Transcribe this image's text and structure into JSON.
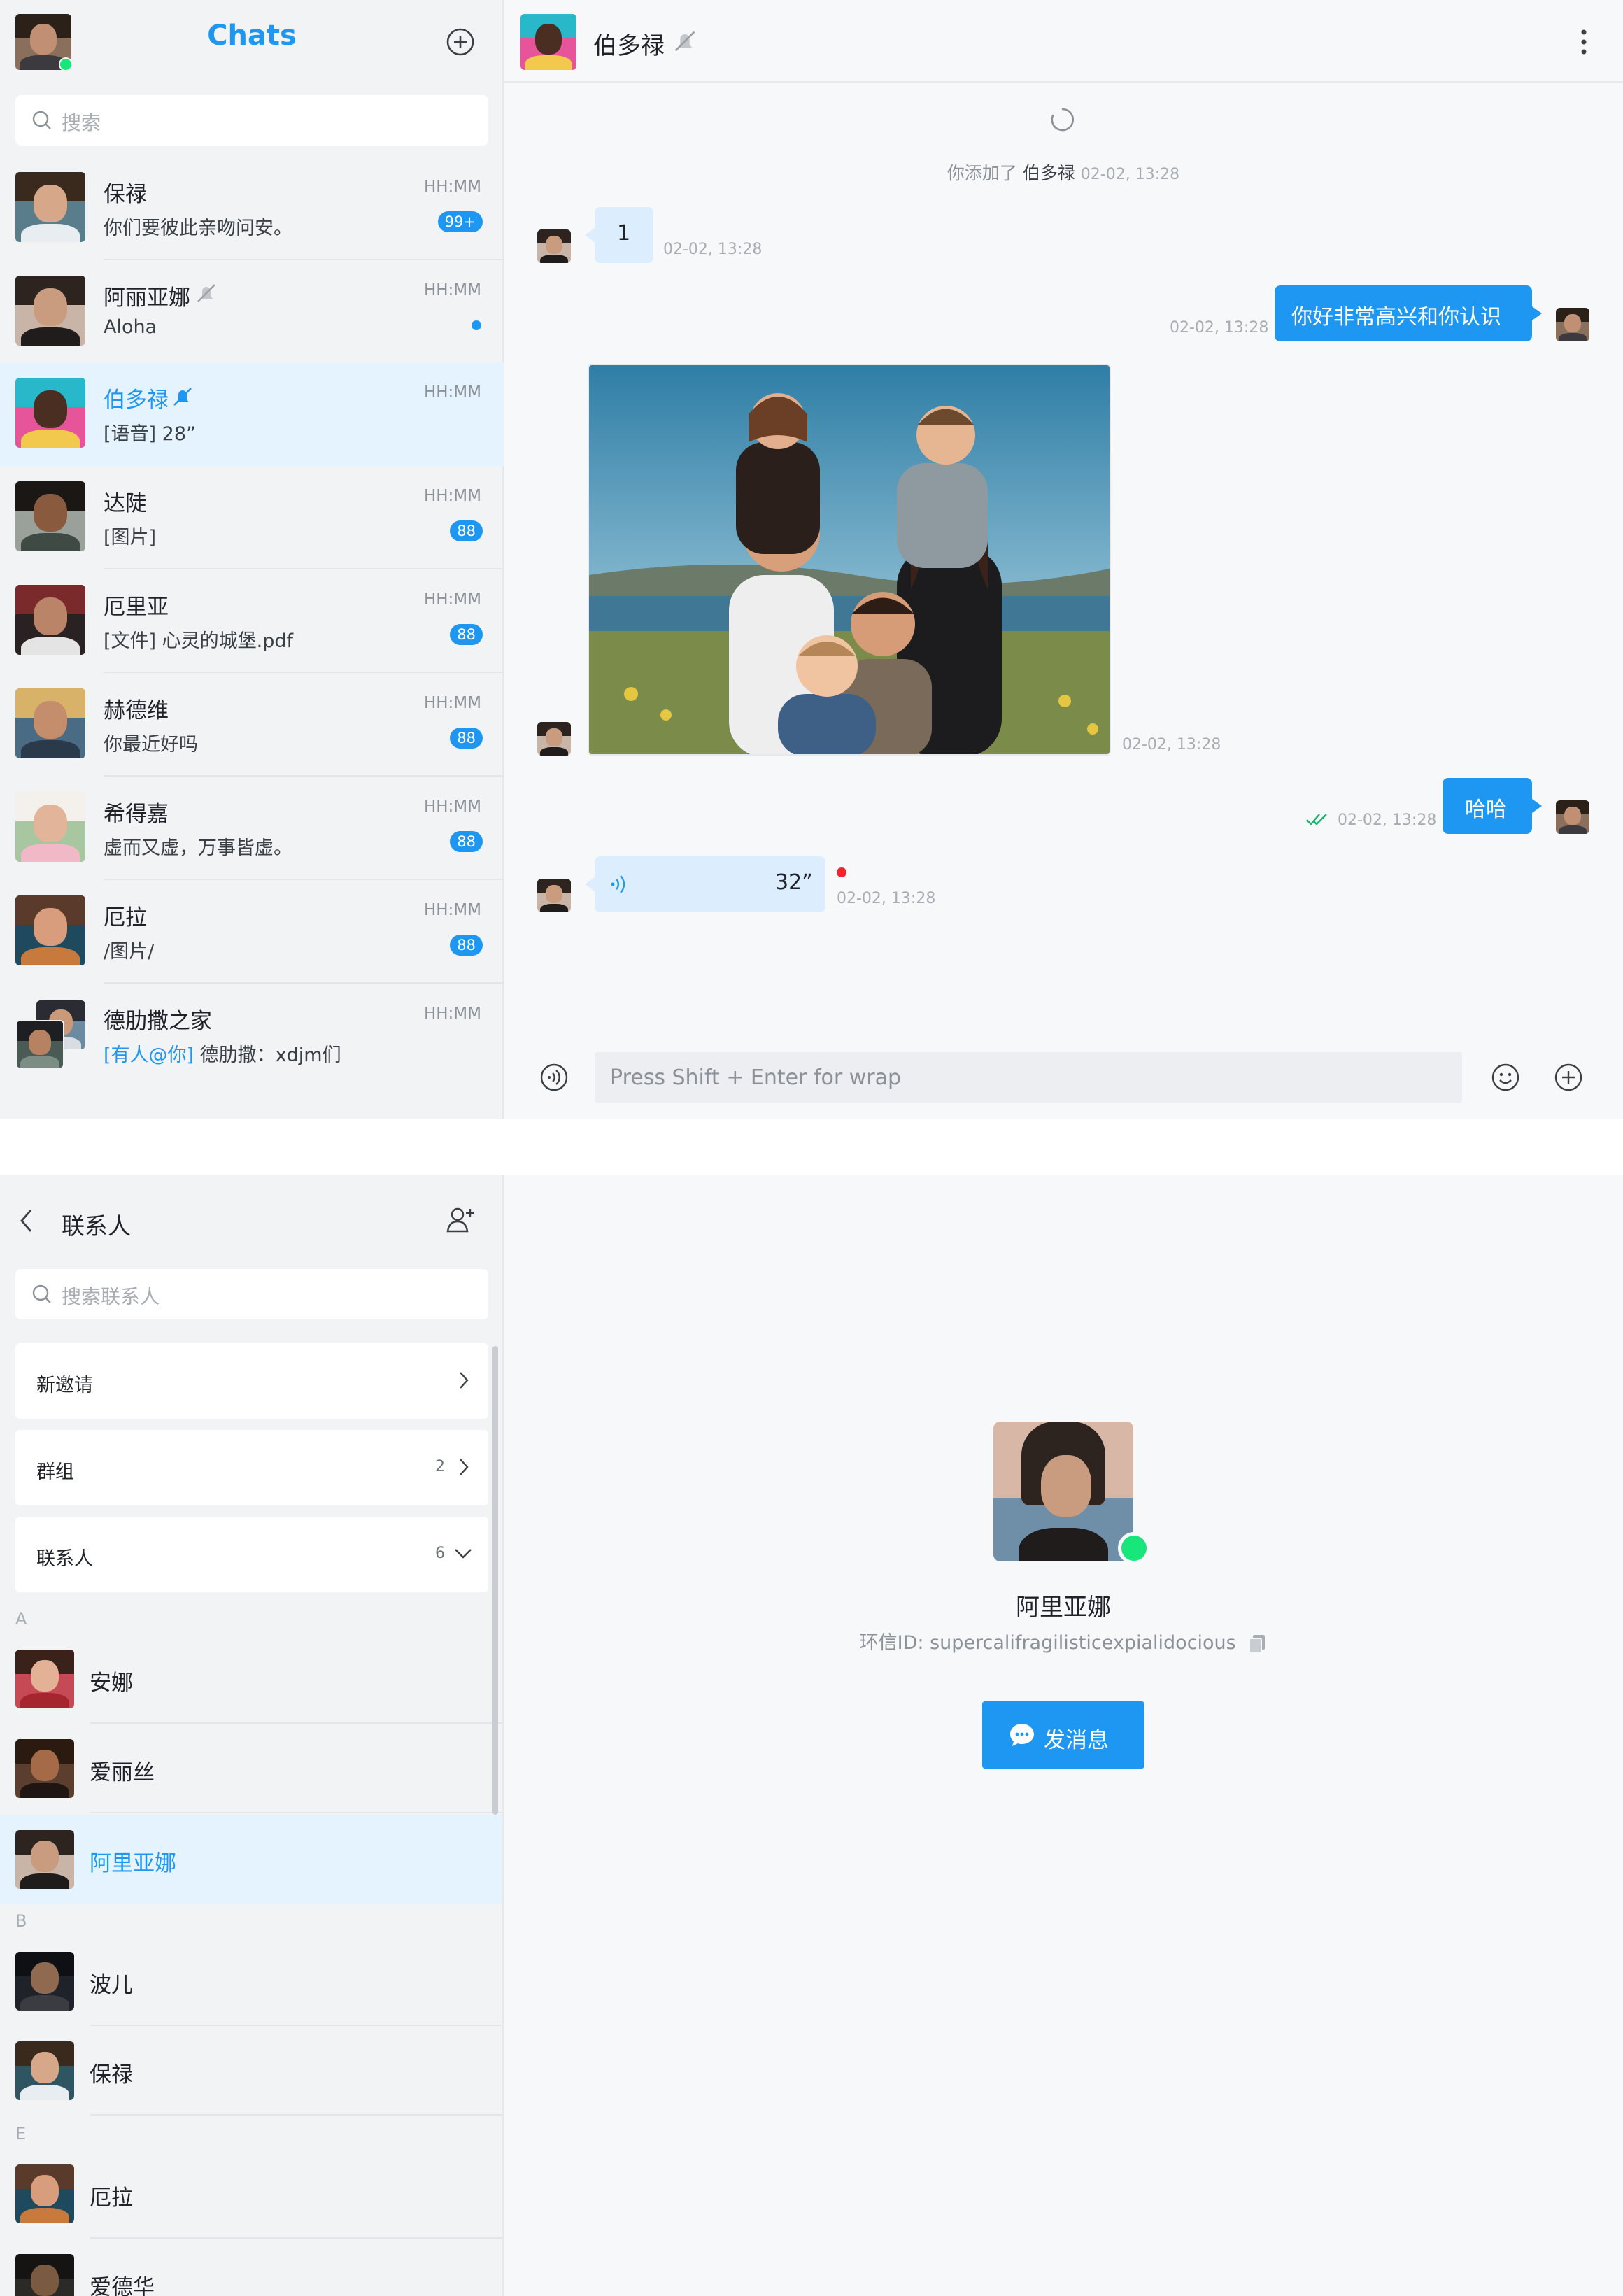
{
  "chat_panel": {
    "title": "Chats",
    "search_placeholder": "搜索",
    "conversations": [
      {
        "name": "保禄",
        "preview": "你们要彼此亲吻问安。",
        "time": "HH:MM",
        "badge": "99+"
      },
      {
        "name": "阿丽亚娜",
        "preview": "Aloha",
        "time": "HH:MM",
        "unread_dot": true,
        "muted": true
      },
      {
        "name": "伯多禄",
        "preview": "[语音] 28”",
        "time": "HH:MM",
        "active": true,
        "muted": true
      },
      {
        "name": "达陡",
        "preview": "[图片]",
        "time": "HH:MM",
        "badge": "88"
      },
      {
        "name": "厄里亚",
        "preview": "[文件] 心灵的城堡.pdf",
        "time": "HH:MM",
        "badge": "88"
      },
      {
        "name": "赫德维",
        "preview": "你最近好吗",
        "time": "HH:MM",
        "badge": "88"
      },
      {
        "name": "希得嘉",
        "preview": "虚而又虚，万事皆虚。",
        "time": "HH:MM",
        "badge": "88"
      },
      {
        "name": "厄拉",
        "preview": "/图片/",
        "time": "HH:MM",
        "badge": "88"
      },
      {
        "name": "德肋撒之家",
        "mention": "[有人@你]",
        "preview": "德肋撒：xdjm们",
        "time": "HH:MM"
      }
    ]
  },
  "conversation": {
    "title": "伯多禄",
    "system_prefix": "你添加了",
    "system_name": "伯多禄",
    "system_time": "02-02, 13:28",
    "messages": [
      {
        "direction": "in",
        "type": "text",
        "text": "1",
        "time": "02-02, 13:28"
      },
      {
        "direction": "out",
        "type": "text",
        "text": "你好非常高兴和你认识",
        "time": "02-02, 13:28"
      },
      {
        "direction": "in",
        "type": "image",
        "alt": "family photo",
        "time": "02-02, 13:28"
      },
      {
        "direction": "out",
        "type": "text",
        "text": "哈哈",
        "time": "02-02, 13:28",
        "read": true
      },
      {
        "direction": "in",
        "type": "voice",
        "duration": "32”",
        "time": "02-02, 13:28",
        "unplayed": true
      }
    ],
    "composer_placeholder": "Press Shift + Enter for wrap"
  },
  "contacts_panel": {
    "title": "联系人",
    "search_placeholder": "搜索联系人",
    "categories": [
      {
        "label": "新邀请",
        "count": ""
      },
      {
        "label": "群组",
        "count": "2"
      },
      {
        "label": "联系人",
        "count": "6"
      }
    ],
    "sections": [
      {
        "letter": "A",
        "contacts": [
          "安娜",
          "爱丽丝",
          "阿里亚娜"
        ]
      },
      {
        "letter": "B",
        "contacts": [
          "波儿",
          "保禄"
        ]
      },
      {
        "letter": "E",
        "contacts": [
          "厄拉",
          "爱德华"
        ]
      }
    ],
    "selected": "阿里亚娜"
  },
  "profile": {
    "name": "阿里亚娜",
    "id_text": "环信ID: supercalifragilisticexpialidocious",
    "send_label": "发消息",
    "online": true
  },
  "colors": {
    "accent": "#1e97f3",
    "online": "#19e67a",
    "unread_red": "#f5222d",
    "bubble_in": "#dcedfd"
  }
}
